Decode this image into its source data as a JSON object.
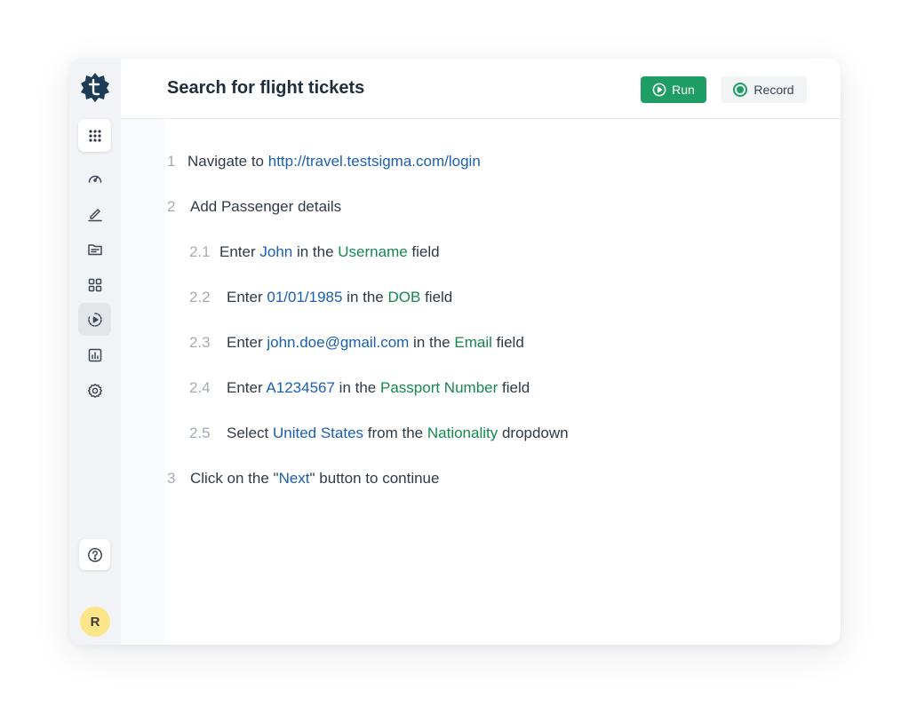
{
  "header": {
    "title": "Search for flight tickets",
    "run_label": "Run",
    "record_label": "Record"
  },
  "sidebar": {
    "avatar_initial": "R",
    "items": [
      {
        "name": "apps-grid-icon"
      },
      {
        "name": "dashboard-gauge-icon"
      },
      {
        "name": "pencil-edit-icon"
      },
      {
        "name": "folder-icon"
      },
      {
        "name": "modules-grid-icon"
      },
      {
        "name": "run-results-icon",
        "active": true
      },
      {
        "name": "reports-chart-icon"
      },
      {
        "name": "settings-gear-icon"
      },
      {
        "name": "help-icon"
      }
    ]
  },
  "steps": [
    {
      "num": "1",
      "t1": "Navigate to ",
      "v1": "http://travel.testsigma.com/login"
    },
    {
      "num": "2",
      "t1": "Add Passenger details"
    },
    {
      "num": "2.1",
      "t1": "Enter ",
      "v1": "John",
      "t2": " in the ",
      "f1": "Username",
      "t3": " field"
    },
    {
      "num": "2.2",
      "t1": "Enter ",
      "v1": "01/01/1985",
      "t2": " in the ",
      "f1": "DOB",
      "t3": " field"
    },
    {
      "num": "2.3",
      "t1": "Enter ",
      "v1": "john.doe@gmail.com",
      "t2": " in the ",
      "f1": "Email",
      "t3": " field"
    },
    {
      "num": "2.4",
      "t1": "Enter ",
      "v1": "A1234567",
      "t2": " in the ",
      "f1": "Passport Number",
      "t3": " field"
    },
    {
      "num": "2.5",
      "t1": "Select ",
      "v1": "United States",
      "t2": " from the ",
      "f1": "Nationality",
      "t3": " dropdown"
    },
    {
      "num": "3",
      "t1": "Click on the \"",
      "v1": "Next",
      "t2": "\" button to continue"
    }
  ]
}
